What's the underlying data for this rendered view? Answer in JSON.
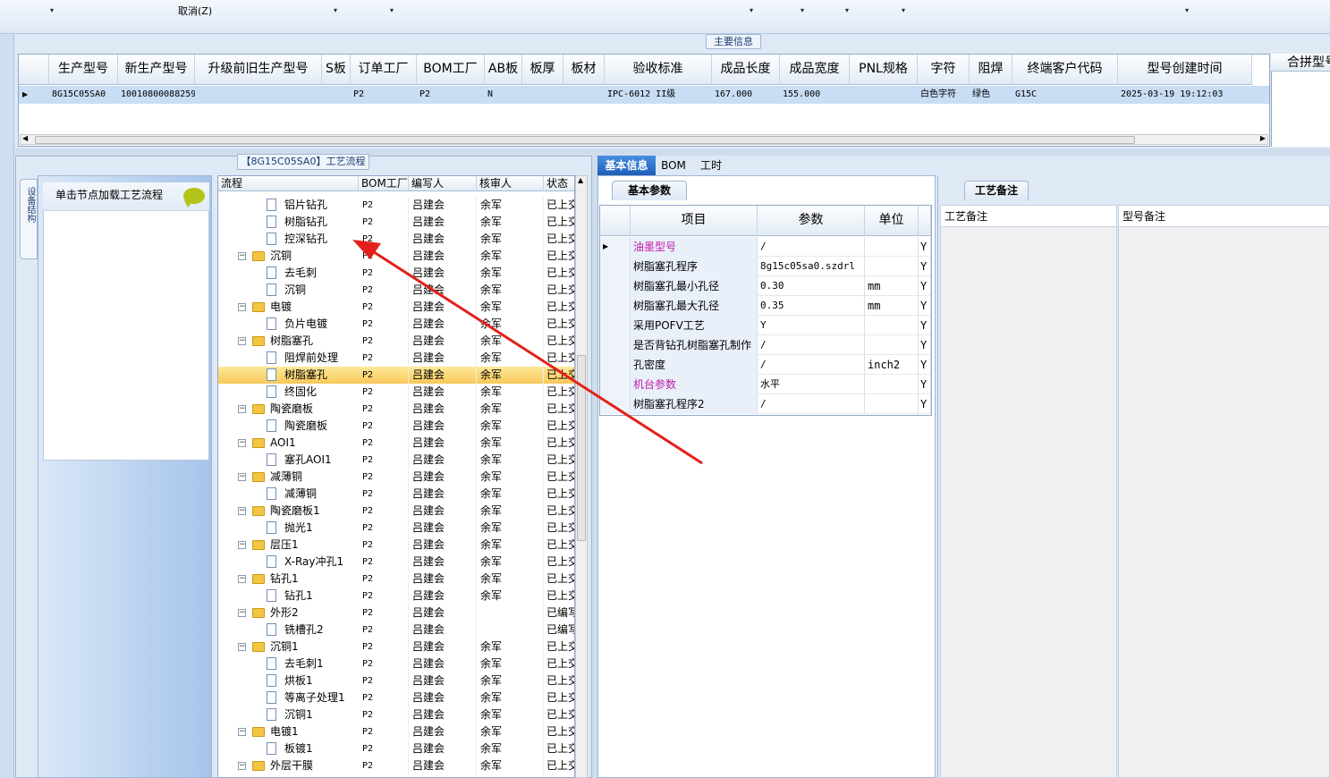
{
  "toolbar": {
    "cancel_label": "取消(Z)",
    "dropdown_glyph": "▾"
  },
  "main_info": {
    "title": "主要信息",
    "columns": [
      "生产型号",
      "新生产型号",
      "升级前旧生产型号",
      "S板",
      "订单工厂",
      "BOM工厂",
      "AB板",
      "板厚",
      "板材",
      "验收标准",
      "成品长度",
      "成品宽度",
      "PNL规格",
      "字符",
      "阻焊",
      "终端客户代码",
      "型号创建时间"
    ],
    "row": [
      "8G15C05SA0",
      "10010800088259",
      "",
      "",
      "P2",
      "P2",
      "N",
      "",
      "",
      "IPC-6012 II级",
      "167.000",
      "155.000",
      "",
      "白色字符",
      "绿色",
      "G15C",
      "2025-03-19 19:12:03"
    ],
    "extra_column": "合拼型号"
  },
  "flow_panel": {
    "title": "【8G15C05SA0】工艺流程",
    "side_tab": "设备结构",
    "nav_title": "单击节点加载工艺流程",
    "columns": [
      "流程",
      "BOM工厂",
      "编写人",
      "核审人",
      "状态"
    ],
    "rows": [
      {
        "level": 1,
        "type": "doc",
        "name": "铝片钻孔",
        "factory": "P2",
        "writer": "吕建会",
        "reviewer": "余军",
        "status": "已上交"
      },
      {
        "level": 1,
        "type": "doc",
        "name": "树脂钻孔",
        "factory": "P2",
        "writer": "吕建会",
        "reviewer": "余军",
        "status": "已上交"
      },
      {
        "level": 1,
        "type": "doc",
        "name": "控深钻孔",
        "factory": "P2",
        "writer": "吕建会",
        "reviewer": "余军",
        "status": "已上交"
      },
      {
        "level": 0,
        "type": "folder",
        "name": "沉铜",
        "factory": "P2",
        "writer": "吕建会",
        "reviewer": "余军",
        "status": "已上交"
      },
      {
        "level": 1,
        "type": "doc",
        "name": "去毛刺",
        "factory": "P2",
        "writer": "吕建会",
        "reviewer": "余军",
        "status": "已上交"
      },
      {
        "level": 1,
        "type": "doc",
        "name": "沉铜",
        "factory": "P2",
        "writer": "吕建会",
        "reviewer": "余军",
        "status": "已上交"
      },
      {
        "level": 0,
        "type": "folder",
        "name": "电镀",
        "factory": "P2",
        "writer": "吕建会",
        "reviewer": "余军",
        "status": "已上交"
      },
      {
        "level": 1,
        "type": "doc",
        "name": "负片电镀",
        "factory": "P2",
        "writer": "吕建会",
        "reviewer": "余军",
        "status": "已上交"
      },
      {
        "level": 0,
        "type": "folder",
        "name": "树脂塞孔",
        "factory": "P2",
        "writer": "吕建会",
        "reviewer": "余军",
        "status": "已上交"
      },
      {
        "level": 1,
        "type": "doc",
        "name": "阻焊前处理",
        "factory": "P2",
        "writer": "吕建会",
        "reviewer": "余军",
        "status": "已上交"
      },
      {
        "level": 1,
        "type": "doc",
        "name": "树脂塞孔",
        "factory": "P2",
        "writer": "吕建会",
        "reviewer": "余军",
        "status": "已上交",
        "selected": true
      },
      {
        "level": 1,
        "type": "doc",
        "name": "终固化",
        "factory": "P2",
        "writer": "吕建会",
        "reviewer": "余军",
        "status": "已上交"
      },
      {
        "level": 0,
        "type": "folder",
        "name": "陶瓷磨板",
        "factory": "P2",
        "writer": "吕建会",
        "reviewer": "余军",
        "status": "已上交"
      },
      {
        "level": 1,
        "type": "doc",
        "name": "陶瓷磨板",
        "factory": "P2",
        "writer": "吕建会",
        "reviewer": "余军",
        "status": "已上交"
      },
      {
        "level": 0,
        "type": "folder",
        "name": "AOI1",
        "factory": "P2",
        "writer": "吕建会",
        "reviewer": "余军",
        "status": "已上交"
      },
      {
        "level": 1,
        "type": "doc",
        "name": "塞孔AOI1",
        "factory": "P2",
        "writer": "吕建会",
        "reviewer": "余军",
        "status": "已上交"
      },
      {
        "level": 0,
        "type": "folder",
        "name": "减薄铜",
        "factory": "P2",
        "writer": "吕建会",
        "reviewer": "余军",
        "status": "已上交"
      },
      {
        "level": 1,
        "type": "doc",
        "name": "减薄铜",
        "factory": "P2",
        "writer": "吕建会",
        "reviewer": "余军",
        "status": "已上交"
      },
      {
        "level": 0,
        "type": "folder",
        "name": "陶瓷磨板1",
        "factory": "P2",
        "writer": "吕建会",
        "reviewer": "余军",
        "status": "已上交"
      },
      {
        "level": 1,
        "type": "doc",
        "name": "抛光1",
        "factory": "P2",
        "writer": "吕建会",
        "reviewer": "余军",
        "status": "已上交"
      },
      {
        "level": 0,
        "type": "folder",
        "name": "层压1",
        "factory": "P2",
        "writer": "吕建会",
        "reviewer": "余军",
        "status": "已上交"
      },
      {
        "level": 1,
        "type": "doc",
        "name": "X-Ray冲孔1",
        "factory": "P2",
        "writer": "吕建会",
        "reviewer": "余军",
        "status": "已上交"
      },
      {
        "level": 0,
        "type": "folder",
        "name": "钻孔1",
        "factory": "P2",
        "writer": "吕建会",
        "reviewer": "余军",
        "status": "已上交"
      },
      {
        "level": 1,
        "type": "doc",
        "name": "钻孔1",
        "factory": "P2",
        "writer": "吕建会",
        "reviewer": "余军",
        "status": "已上交"
      },
      {
        "level": 0,
        "type": "folder",
        "name": "外形2",
        "factory": "P2",
        "writer": "吕建会",
        "reviewer": "",
        "status": "已编写"
      },
      {
        "level": 1,
        "type": "doc",
        "name": "铣槽孔2",
        "factory": "P2",
        "writer": "吕建会",
        "reviewer": "",
        "status": "已编写"
      },
      {
        "level": 0,
        "type": "folder",
        "name": "沉铜1",
        "factory": "P2",
        "writer": "吕建会",
        "reviewer": "余军",
        "status": "已上交"
      },
      {
        "level": 1,
        "type": "doc",
        "name": "去毛刺1",
        "factory": "P2",
        "writer": "吕建会",
        "reviewer": "余军",
        "status": "已上交"
      },
      {
        "level": 1,
        "type": "doc",
        "name": "烘板1",
        "factory": "P2",
        "writer": "吕建会",
        "reviewer": "余军",
        "status": "已上交"
      },
      {
        "level": 1,
        "type": "doc",
        "name": "等离子处理1",
        "factory": "P2",
        "writer": "吕建会",
        "reviewer": "余军",
        "status": "已上交"
      },
      {
        "level": 1,
        "type": "doc",
        "name": "沉铜1",
        "factory": "P2",
        "writer": "吕建会",
        "reviewer": "余军",
        "status": "已上交"
      },
      {
        "level": 0,
        "type": "folder",
        "name": "电镀1",
        "factory": "P2",
        "writer": "吕建会",
        "reviewer": "余军",
        "status": "已上交"
      },
      {
        "level": 1,
        "type": "doc",
        "name": "板镀1",
        "factory": "P2",
        "writer": "吕建会",
        "reviewer": "余军",
        "status": "已上交"
      },
      {
        "level": 0,
        "type": "folder",
        "name": "外层干膜",
        "factory": "P2",
        "writer": "吕建会",
        "reviewer": "余军",
        "status": "已上交"
      }
    ]
  },
  "detail": {
    "tabs": [
      "基本信息",
      "BOM",
      "工时"
    ],
    "params_tab": "基本参数",
    "param_columns": [
      "项目",
      "参数",
      "单位"
    ],
    "params": [
      {
        "item": "油墨型号",
        "value": "/",
        "unit": "",
        "flag": "Y",
        "highlight": true,
        "current": true
      },
      {
        "item": "树脂塞孔程序",
        "value": "8g15c05sa0.szdrl",
        "unit": "",
        "flag": "Y"
      },
      {
        "item": "树脂塞孔最小孔径",
        "value": "0.30",
        "unit": "mm",
        "flag": "Y"
      },
      {
        "item": "树脂塞孔最大孔径",
        "value": "0.35",
        "unit": "mm",
        "flag": "Y"
      },
      {
        "item": "采用POFV工艺",
        "value": "Y",
        "unit": "",
        "flag": "Y"
      },
      {
        "item": "是否背钻孔树脂塞孔制作",
        "value": "/",
        "unit": "",
        "flag": "Y"
      },
      {
        "item": "孔密度",
        "value": "/",
        "unit": "inch2",
        "flag": "Y"
      },
      {
        "item": "机台参数",
        "value": "水平",
        "unit": "",
        "flag": "Y",
        "highlight": true
      },
      {
        "item": "树脂塞孔程序2",
        "value": "/",
        "unit": "",
        "flag": "Y"
      }
    ],
    "remarks_tab": "工艺备注",
    "remark_columns": [
      "工艺备注",
      "型号备注"
    ]
  },
  "colors": {
    "selection": "#f8c85a",
    "row_highlight": "#c9ddf4",
    "accent_tab": "#1c5fb8",
    "magenta_text": "#c21ba2",
    "annotation_arrow": "#e3201b",
    "chat_icon": "#b3c419"
  }
}
